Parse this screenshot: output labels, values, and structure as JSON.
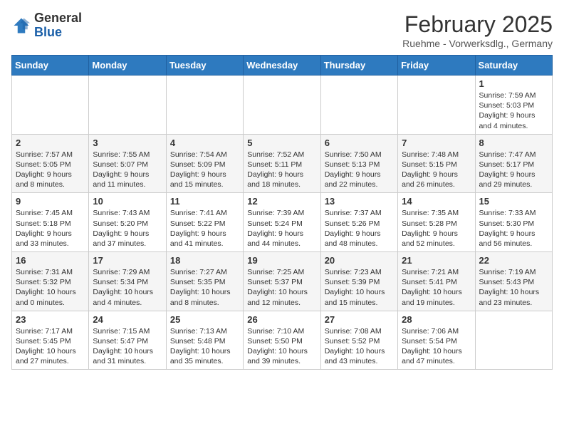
{
  "header": {
    "logo_general": "General",
    "logo_blue": "Blue",
    "month_title": "February 2025",
    "subtitle": "Ruehme - Vorwerksdlg., Germany"
  },
  "weekdays": [
    "Sunday",
    "Monday",
    "Tuesday",
    "Wednesday",
    "Thursday",
    "Friday",
    "Saturday"
  ],
  "weeks": [
    [
      {
        "day": "",
        "info": ""
      },
      {
        "day": "",
        "info": ""
      },
      {
        "day": "",
        "info": ""
      },
      {
        "day": "",
        "info": ""
      },
      {
        "day": "",
        "info": ""
      },
      {
        "day": "",
        "info": ""
      },
      {
        "day": "1",
        "info": "Sunrise: 7:59 AM\nSunset: 5:03 PM\nDaylight: 9 hours and 4 minutes."
      }
    ],
    [
      {
        "day": "2",
        "info": "Sunrise: 7:57 AM\nSunset: 5:05 PM\nDaylight: 9 hours and 8 minutes."
      },
      {
        "day": "3",
        "info": "Sunrise: 7:55 AM\nSunset: 5:07 PM\nDaylight: 9 hours and 11 minutes."
      },
      {
        "day": "4",
        "info": "Sunrise: 7:54 AM\nSunset: 5:09 PM\nDaylight: 9 hours and 15 minutes."
      },
      {
        "day": "5",
        "info": "Sunrise: 7:52 AM\nSunset: 5:11 PM\nDaylight: 9 hours and 18 minutes."
      },
      {
        "day": "6",
        "info": "Sunrise: 7:50 AM\nSunset: 5:13 PM\nDaylight: 9 hours and 22 minutes."
      },
      {
        "day": "7",
        "info": "Sunrise: 7:48 AM\nSunset: 5:15 PM\nDaylight: 9 hours and 26 minutes."
      },
      {
        "day": "8",
        "info": "Sunrise: 7:47 AM\nSunset: 5:17 PM\nDaylight: 9 hours and 29 minutes."
      }
    ],
    [
      {
        "day": "9",
        "info": "Sunrise: 7:45 AM\nSunset: 5:18 PM\nDaylight: 9 hours and 33 minutes."
      },
      {
        "day": "10",
        "info": "Sunrise: 7:43 AM\nSunset: 5:20 PM\nDaylight: 9 hours and 37 minutes."
      },
      {
        "day": "11",
        "info": "Sunrise: 7:41 AM\nSunset: 5:22 PM\nDaylight: 9 hours and 41 minutes."
      },
      {
        "day": "12",
        "info": "Sunrise: 7:39 AM\nSunset: 5:24 PM\nDaylight: 9 hours and 44 minutes."
      },
      {
        "day": "13",
        "info": "Sunrise: 7:37 AM\nSunset: 5:26 PM\nDaylight: 9 hours and 48 minutes."
      },
      {
        "day": "14",
        "info": "Sunrise: 7:35 AM\nSunset: 5:28 PM\nDaylight: 9 hours and 52 minutes."
      },
      {
        "day": "15",
        "info": "Sunrise: 7:33 AM\nSunset: 5:30 PM\nDaylight: 9 hours and 56 minutes."
      }
    ],
    [
      {
        "day": "16",
        "info": "Sunrise: 7:31 AM\nSunset: 5:32 PM\nDaylight: 10 hours and 0 minutes."
      },
      {
        "day": "17",
        "info": "Sunrise: 7:29 AM\nSunset: 5:34 PM\nDaylight: 10 hours and 4 minutes."
      },
      {
        "day": "18",
        "info": "Sunrise: 7:27 AM\nSunset: 5:35 PM\nDaylight: 10 hours and 8 minutes."
      },
      {
        "day": "19",
        "info": "Sunrise: 7:25 AM\nSunset: 5:37 PM\nDaylight: 10 hours and 12 minutes."
      },
      {
        "day": "20",
        "info": "Sunrise: 7:23 AM\nSunset: 5:39 PM\nDaylight: 10 hours and 15 minutes."
      },
      {
        "day": "21",
        "info": "Sunrise: 7:21 AM\nSunset: 5:41 PM\nDaylight: 10 hours and 19 minutes."
      },
      {
        "day": "22",
        "info": "Sunrise: 7:19 AM\nSunset: 5:43 PM\nDaylight: 10 hours and 23 minutes."
      }
    ],
    [
      {
        "day": "23",
        "info": "Sunrise: 7:17 AM\nSunset: 5:45 PM\nDaylight: 10 hours and 27 minutes."
      },
      {
        "day": "24",
        "info": "Sunrise: 7:15 AM\nSunset: 5:47 PM\nDaylight: 10 hours and 31 minutes."
      },
      {
        "day": "25",
        "info": "Sunrise: 7:13 AM\nSunset: 5:48 PM\nDaylight: 10 hours and 35 minutes."
      },
      {
        "day": "26",
        "info": "Sunrise: 7:10 AM\nSunset: 5:50 PM\nDaylight: 10 hours and 39 minutes."
      },
      {
        "day": "27",
        "info": "Sunrise: 7:08 AM\nSunset: 5:52 PM\nDaylight: 10 hours and 43 minutes."
      },
      {
        "day": "28",
        "info": "Sunrise: 7:06 AM\nSunset: 5:54 PM\nDaylight: 10 hours and 47 minutes."
      },
      {
        "day": "",
        "info": ""
      }
    ]
  ]
}
